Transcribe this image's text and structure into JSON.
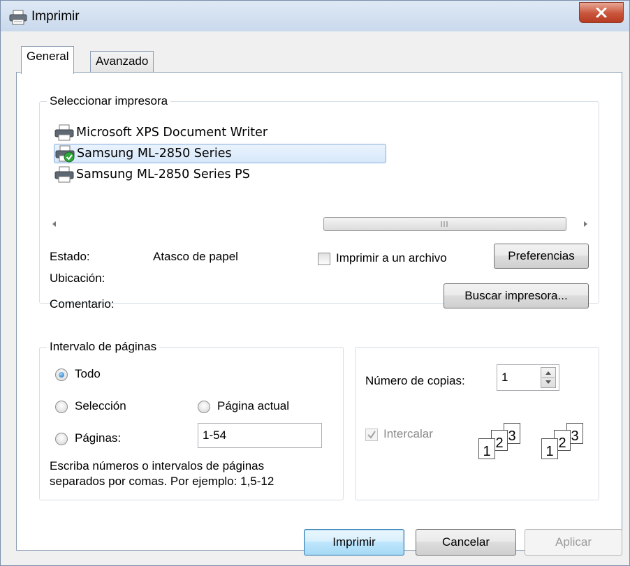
{
  "window": {
    "title": "Imprimir"
  },
  "tabs": [
    {
      "label": "General"
    },
    {
      "label": "Avanzado"
    }
  ],
  "printer_group": {
    "legend": "Seleccionar impresora",
    "printers": [
      {
        "name": "Microsoft XPS Document Writer"
      },
      {
        "name": "Samsung ML-2850 Series",
        "selected": true,
        "default": true
      },
      {
        "name": "Samsung ML-2850 Series PS"
      }
    ],
    "status_label": "Estado:",
    "status_value": "Atasco de papel",
    "location_label": "Ubicación:",
    "comment_label": "Comentario:",
    "print_to_file_label": "Imprimir a un archivo",
    "print_to_file_checked": false,
    "preferences_button": "Preferencias",
    "find_printer_button": "Buscar impresora..."
  },
  "page_range": {
    "legend": "Intervalo de páginas",
    "option_all": "Todo",
    "option_selection": "Selección",
    "option_current": "Página actual",
    "option_pages": "Páginas:",
    "selected_option": "Todo",
    "pages_value": "1-54",
    "help_line1": "Escriba números o intervalos de páginas",
    "help_line2": "separados por comas. Por ejemplo: 1,5-12"
  },
  "copies": {
    "label": "Número de copias:",
    "value": "1",
    "collate_label": "Intercalar",
    "collate_checked": true,
    "collate_enabled": false
  },
  "buttons": {
    "print": "Imprimir",
    "cancel": "Cancelar",
    "apply": "Aplicar"
  },
  "colors": {
    "selection_bg": "#dcebfc",
    "selection_border": "#84acdd",
    "close_red": "#c9553b"
  }
}
